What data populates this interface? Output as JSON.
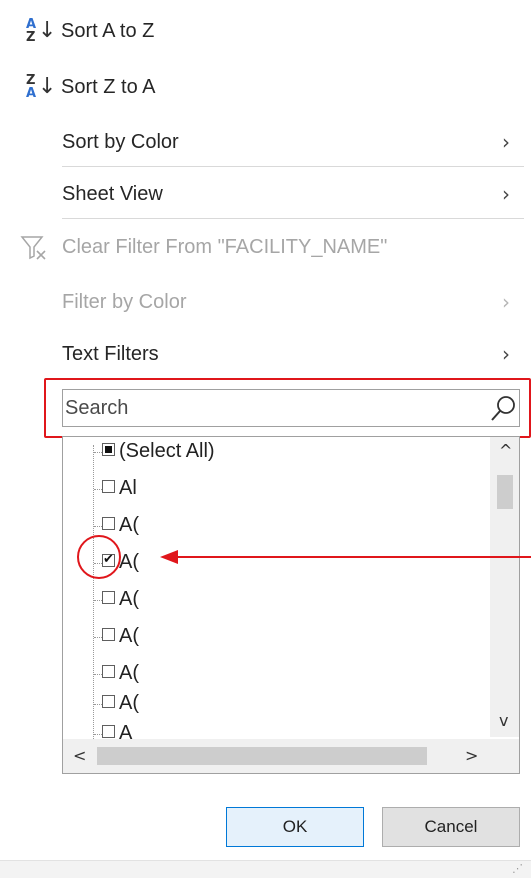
{
  "menu": {
    "sort_az": {
      "label": "Sort A to Z",
      "icon": "sort-ascending-icon",
      "icon_top": "A",
      "icon_bottom": "Z",
      "top_color": "#2f6fcf",
      "bottom_color": "#333333"
    },
    "sort_za": {
      "label": "Sort Z to A",
      "icon": "sort-descending-icon",
      "icon_top": "Z",
      "icon_bottom": "A",
      "top_color": "#333333",
      "bottom_color": "#2f6fcf"
    },
    "sort_by_color": {
      "label": "Sort by Color",
      "arrow": "›"
    },
    "sheet_view": {
      "label": "Sheet View",
      "arrow": "›"
    },
    "clear_filter": {
      "label": "Clear Filter From \"FACILITY_NAME\"",
      "icon": "clear-filter-icon",
      "enabled": false
    },
    "filter_by_color": {
      "label": "Filter by Color",
      "arrow": "›",
      "enabled": false
    },
    "text_filters": {
      "label": "Text Filters",
      "arrow": "›"
    }
  },
  "search": {
    "placeholder": "Search",
    "value": "",
    "icon": "search-icon"
  },
  "list": {
    "items": [
      {
        "label": "(Select All)",
        "state": "indeterminate"
      },
      {
        "label": "Al",
        "state": "unchecked"
      },
      {
        "label": "A(",
        "state": "unchecked"
      },
      {
        "label": "A(",
        "state": "checked"
      },
      {
        "label": "A(",
        "state": "unchecked"
      },
      {
        "label": "A(",
        "state": "unchecked"
      },
      {
        "label": "A(",
        "state": "unchecked"
      },
      {
        "label": "A(",
        "state": "unchecked"
      },
      {
        "label": "A",
        "state": "unchecked"
      }
    ],
    "scroll_up": "^",
    "scroll_down": "v",
    "scroll_left": "<",
    "scroll_right": ">"
  },
  "buttons": {
    "ok": "OK",
    "cancel": "Cancel"
  },
  "annotations": {
    "highlight_color": "#e0161b"
  }
}
